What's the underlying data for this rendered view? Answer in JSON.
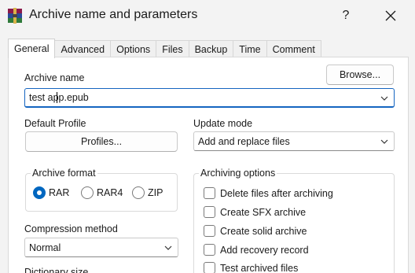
{
  "window": {
    "title": "Archive name and parameters",
    "help_label": "?",
    "close_label": "✕"
  },
  "tabs": [
    {
      "label": "General",
      "active": true
    },
    {
      "label": "Advanced"
    },
    {
      "label": "Options"
    },
    {
      "label": "Files"
    },
    {
      "label": "Backup"
    },
    {
      "label": "Time"
    },
    {
      "label": "Comment"
    }
  ],
  "archive_name": {
    "label": "Archive name",
    "value": "test app.epub",
    "browse_label": "Browse..."
  },
  "default_profile": {
    "label": "Default Profile",
    "button_label": "Profiles..."
  },
  "update_mode": {
    "label": "Update mode",
    "value": "Add and replace files"
  },
  "archive_format": {
    "label": "Archive format",
    "options": [
      "RAR",
      "RAR4",
      "ZIP"
    ],
    "selected": "RAR"
  },
  "archiving_options": {
    "label": "Archiving options",
    "items": [
      {
        "label": "Delete files after archiving",
        "checked": false
      },
      {
        "label": "Create SFX archive",
        "checked": false
      },
      {
        "label": "Create solid archive",
        "checked": false
      },
      {
        "label": "Add recovery record",
        "checked": false
      },
      {
        "label": "Test archived files",
        "checked": false
      }
    ]
  },
  "compression_method": {
    "label": "Compression method",
    "value": "Normal"
  },
  "dictionary_size": {
    "label": "Dictionary size"
  },
  "colors": {
    "accent": "#0067c0",
    "focus": "#1565c0"
  }
}
